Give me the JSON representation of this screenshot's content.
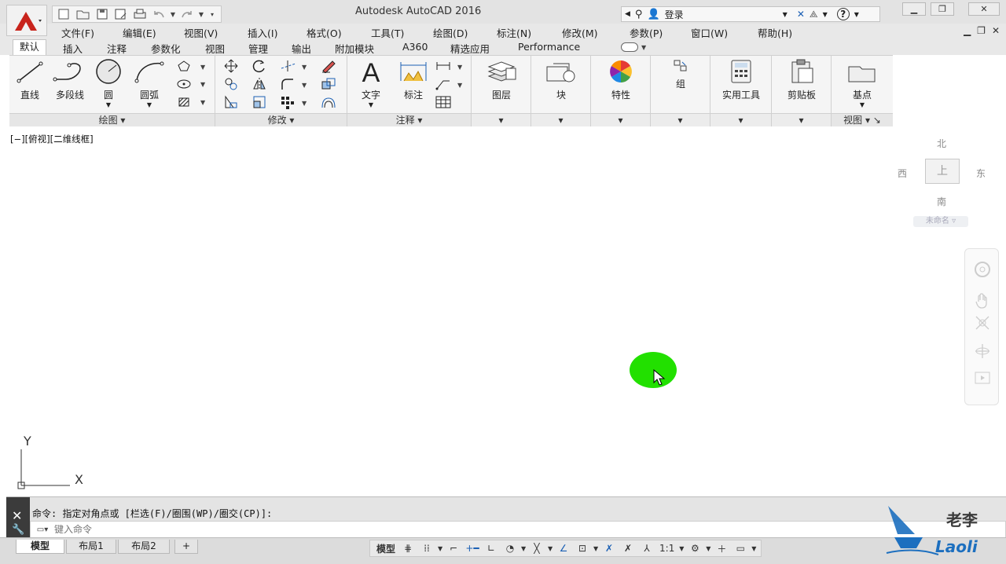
{
  "title_bar": {
    "app_title": "Autodesk AutoCAD 2016",
    "login_label": "登录",
    "help_label": "?"
  },
  "menu": {
    "items": [
      "文件(F)",
      "编辑(E)",
      "视图(V)",
      "插入(I)",
      "格式(O)",
      "工具(T)",
      "绘图(D)",
      "标注(N)",
      "修改(M)",
      "参数(P)",
      "窗口(W)",
      "帮助(H)"
    ]
  },
  "ribbon_tabs": {
    "items": [
      "默认",
      "插入",
      "注释",
      "参数化",
      "视图",
      "管理",
      "输出",
      "附加模块",
      "A360",
      "精选应用",
      "Performance"
    ],
    "active": "默认"
  },
  "ribbon": {
    "draw": {
      "title": "绘图",
      "line": "直线",
      "polyline": "多段线",
      "circle": "圆",
      "arc": "圆弧"
    },
    "modify": {
      "title": "修改"
    },
    "annotation": {
      "title": "注释",
      "text": "文字",
      "dimension": "标注"
    },
    "layers": {
      "title": "图层"
    },
    "block": {
      "title": "块"
    },
    "properties": {
      "title": "特性"
    },
    "groups": {
      "title": "组"
    },
    "utilities": {
      "title": "实用工具"
    },
    "clipboard": {
      "title": "剪贴板"
    },
    "view": {
      "title": "视图",
      "base": "基点"
    }
  },
  "viewport": {
    "label": "[−][俯视][二维线框]"
  },
  "viewcube": {
    "north": "北",
    "south": "南",
    "east": "东",
    "west": "西",
    "top_face": "上",
    "ucs_name": "未命名"
  },
  "ucs_icon": {
    "y_label": "Y",
    "x_label": "X"
  },
  "command_line": {
    "history": "命令: 指定对角点或 [栏选(F)/圈围(WP)/圈交(CP)]:",
    "placeholder": "键入命令"
  },
  "layout_tabs": [
    "模型",
    "布局1",
    "布局2",
    "+"
  ],
  "status_bar": {
    "model_label": "模型",
    "scale": "1:1"
  },
  "watermark": {
    "cn": "老李",
    "en": "Laoli"
  },
  "colors": {
    "cursor_highlight": "#22e000",
    "app_logo": "#c8241c",
    "watermark_blue": "#1c6fbf"
  }
}
